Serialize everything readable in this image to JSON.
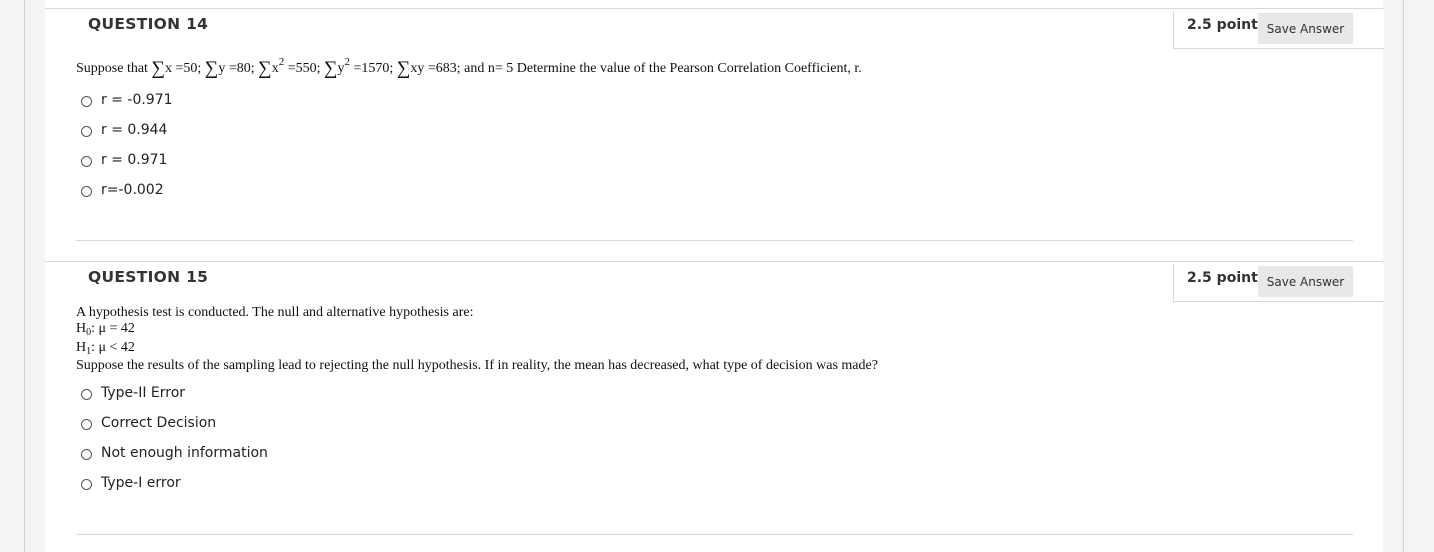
{
  "questions": [
    {
      "title": "QUESTION 14",
      "points": "2.5 points",
      "save_label": "Save Answer",
      "prompt": {
        "p1": "Suppose that ",
        "sigma": "∑",
        "x": "x",
        "t1": " =50; ",
        "y": "y",
        "t2": " =80; ",
        "x2": "x",
        "sq": "2",
        "t3": " =550; ",
        "y2": "y",
        "t4": " =1570; ",
        "xy": "xy",
        "t5": " =683; and n= 5 Determine the value of the Pearson Correlation Coefficient, r."
      },
      "options": [
        "r = -0.971",
        "r = 0.944",
        "r = 0.971",
        "r=-0.002"
      ]
    },
    {
      "title": "QUESTION 15",
      "points": "2.5 points",
      "save_label": "Save Answer",
      "prompt": {
        "line1": "A hypothesis test is conducted. The null and alternative hypothesis are:",
        "h": "H",
        "sub0": "0",
        "h0_rest": ": μ = 42",
        "sub1": "1",
        "h1_rest": ": μ < 42",
        "line4": "Suppose the results of the sampling lead to rejecting the null hypothesis. If in reality, the mean has decreased, what type of decision was made?"
      },
      "options": [
        "Type-II Error",
        "Correct Decision",
        "Not enough information",
        "Type-I error"
      ]
    }
  ]
}
